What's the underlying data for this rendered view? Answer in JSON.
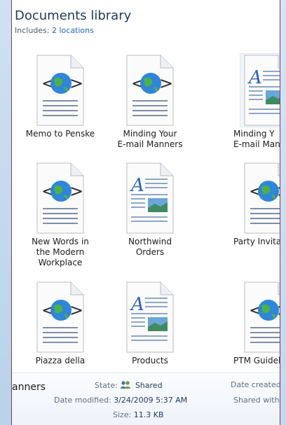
{
  "library": {
    "title": "Documents library",
    "includes_label": "Includes:",
    "locations_link": "2 locations"
  },
  "files": [
    {
      "line1": "Memo to Penske",
      "line2": "",
      "line3": "",
      "icon": "html-document-icon"
    },
    {
      "line1": "Minding Your",
      "line2": "E-mail Manners",
      "line3": "",
      "icon": "html-document-icon"
    },
    {
      "line1": "Minding Y",
      "line2": "E-mail Man",
      "line3": "",
      "icon": "word-document-icon"
    },
    {
      "line1": "New Words in",
      "line2": "the Modern",
      "line3": "Workplace",
      "icon": "html-document-icon"
    },
    {
      "line1": "Northwind",
      "line2": "Orders",
      "line3": "",
      "icon": "word-document-icon"
    },
    {
      "line1": "Party Invitat",
      "line2": "",
      "line3": "",
      "icon": "html-document-icon"
    },
    {
      "line1": "Piazza della",
      "line2": "",
      "line3": "",
      "icon": "html-document-icon"
    },
    {
      "line1": "Products",
      "line2": "",
      "line3": "",
      "icon": "word-document-icon"
    },
    {
      "line1": "PTM Guidel",
      "line2": "",
      "line3": "",
      "icon": "html-document-icon"
    }
  ],
  "details": {
    "name_partial": "anners",
    "state_label": "State:",
    "state_value": "Shared",
    "date_modified_label": "Date modified:",
    "date_modified_value": "3/24/2009 5:37 AM",
    "size_label": "Size:",
    "size_value": "11.3 KB",
    "date_created_label": "Date created:",
    "shared_with_label": "Shared with:"
  },
  "colors": {
    "title": "#1e395b",
    "link": "#1e6bbf",
    "window_border": "#7d3b5b",
    "globe": "#2f86d8"
  }
}
